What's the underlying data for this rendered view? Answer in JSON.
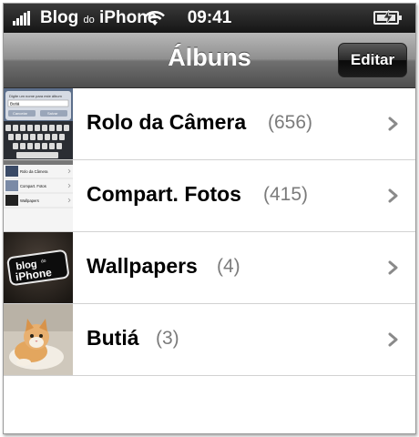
{
  "status_bar": {
    "carrier_main": "Blog",
    "carrier_small": "do",
    "carrier_end": "iPhone",
    "time": "09:41",
    "icons": [
      "signal-icon",
      "wifi-icon",
      "battery-charging-icon"
    ]
  },
  "nav": {
    "title": "Álbuns",
    "edit_label": "Editar"
  },
  "albums": [
    {
      "name": "Rolo da Câmera",
      "count": "(656)",
      "thumb": "keyboard-screenshot-thumb"
    },
    {
      "name": "Compart. Fotos",
      "count": "(415)",
      "thumb": "list-screenshot-thumb"
    },
    {
      "name": "Wallpapers",
      "count": "(4)",
      "thumb": "blog-do-iphone-logo-thumb",
      "thumb_text": "blog do iPhone"
    },
    {
      "name": "Butiá",
      "count": "(3)",
      "thumb": "kitten-photo-thumb"
    }
  ],
  "thumb_texts": {
    "album1_a": "Digite um nome para este álbum",
    "album1_b": "Butiá",
    "album1_c": "Cancelar",
    "album1_d": "Salvar",
    "album2_a": "Rolo da Câmera",
    "album2_b": "Compart. Fotos",
    "album2_c": "Wallpapers"
  },
  "colors": {
    "navbar_top": "#b8b8b8",
    "navbar_bottom": "#4e4e4e",
    "count_gray": "#7b7b7b",
    "chevron_gray": "#8a8a8a"
  }
}
